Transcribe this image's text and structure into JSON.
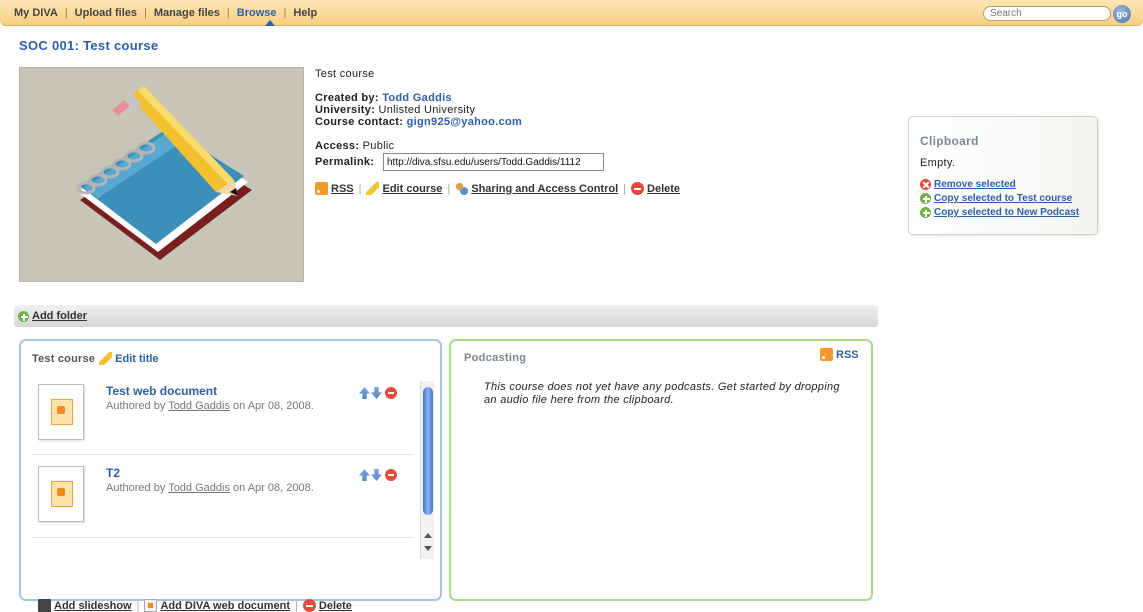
{
  "nav": {
    "items": [
      "My DIVA",
      "Upload files",
      "Manage files",
      "Browse",
      "Help"
    ],
    "active": "Browse",
    "search_placeholder": "Search",
    "go_label": "go"
  },
  "page_title": "SOC 001: Test course",
  "course": {
    "name": "Test course",
    "created_by_label": "Created by:",
    "created_by": "Todd Gaddis",
    "university_label": "University:",
    "university": "Unlisted University",
    "contact_label": "Course contact:",
    "contact": "gign925@yahoo.com",
    "access_label": "Access:",
    "access": "Public",
    "permalink_label": "Permalink:",
    "permalink": "http://diva.sfsu.edu/users/Todd.Gaddis/1112"
  },
  "actions": {
    "rss": "RSS",
    "edit": "Edit course",
    "sharing": "Sharing and Access Control",
    "delete": "Delete"
  },
  "clipboard": {
    "title": "Clipboard",
    "status": "Empty.",
    "remove": "Remove selected",
    "copy_course": "Copy selected to Test course",
    "copy_podcast": "Copy selected to New Podcast"
  },
  "folder_bar": {
    "add_folder": "Add folder"
  },
  "folder_panel": {
    "title": "Test course",
    "edit_title": "Edit title",
    "items": [
      {
        "title": "Test web document",
        "prefix": "Authored by",
        "author": "Todd Gaddis",
        "date": "on Apr 08, 2008."
      },
      {
        "title": "T2",
        "prefix": "Authored by",
        "author": "Todd Gaddis",
        "date": "on Apr 08, 2008."
      }
    ],
    "footer": {
      "add_slideshow": "Add slideshow",
      "add_web_doc": "Add DIVA web document",
      "delete": "Delete"
    }
  },
  "podcast_panel": {
    "title": "Podcasting",
    "rss": "RSS",
    "message": "This course does not yet have any podcasts. Get started by dropping an audio file here from the clipboard."
  }
}
